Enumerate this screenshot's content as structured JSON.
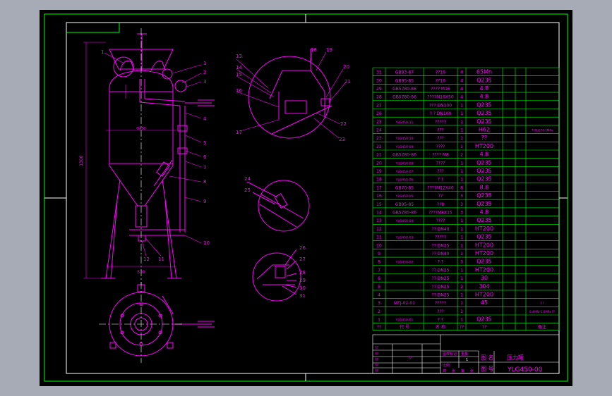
{
  "colors": {
    "canvas": "#000000",
    "frame": "#00ff00",
    "ink": "#ff00ff",
    "text": "#ffffff",
    "window": "#a6abb5"
  },
  "callouts_main": [
    "1",
    "2",
    "3",
    "4",
    "5",
    "6",
    "7",
    "8",
    "9",
    "10",
    "11",
    "12"
  ],
  "callouts_detail_top": [
    "13",
    "14",
    "15",
    "16",
    "17",
    "18",
    "19",
    "20",
    "21",
    "22",
    "23"
  ],
  "callouts_detail_mid": [
    "24",
    "25"
  ],
  "callouts_detail_low": [
    "26",
    "27",
    "28",
    "29",
    "30",
    "31"
  ],
  "dims": {
    "height": "1300",
    "diameter": "Φ450",
    "base": "530",
    "top_left": "Φ",
    "top_right": "Φ"
  },
  "bom_rows": [
    {
      "no": "31",
      "code": "GB93-87",
      "name": "??16",
      "qty": "4",
      "mat": "65Mn",
      "note": ""
    },
    {
      "no": "30",
      "code": "GB95-85",
      "name": "??16",
      "qty": "4",
      "mat": "Q235",
      "note": ""
    },
    {
      "no": "29",
      "code": "GB5780-86",
      "name": "????  M16",
      "qty": "4",
      "mat": "4.8",
      "note": ""
    },
    {
      "no": "28",
      "code": "GB5780-86",
      "name": "????M16X50",
      "qty": "4",
      "mat": "4.8",
      "note": ""
    },
    {
      "no": "27",
      "code": "",
      "name": "???  DN100",
      "qty": "1",
      "mat": "Q235",
      "note": ""
    },
    {
      "no": "26",
      "code": "",
      "name": "? ?  DN100",
      "qty": "1",
      "mat": "Q235",
      "note": ""
    },
    {
      "no": "25",
      "code": "YLG450-11",
      "name": "?????",
      "qty": "1",
      "mat": "Q235",
      "note": ""
    },
    {
      "no": "24",
      "code": "",
      "name": "???",
      "qty": "1",
      "mat": "H62",
      "note": "???1/270-1MPa"
    },
    {
      "no": "23",
      "code": "YLG450-10",
      "name": "???",
      "qty": "1",
      "mat": "??",
      "note": ""
    },
    {
      "no": "22",
      "code": "YLG450-09",
      "name": "????",
      "qty": "1",
      "mat": "HT200",
      "note": ""
    },
    {
      "no": "21",
      "code": "GB5780-86",
      "name": "????  M8",
      "qty": "2",
      "mat": "4.8",
      "note": ""
    },
    {
      "no": "20",
      "code": "YLG450-08",
      "name": "????",
      "qty": "1",
      "mat": "Q235",
      "note": ""
    },
    {
      "no": "19",
      "code": "YLG450-07",
      "name": "???",
      "qty": "1",
      "mat": "Q235",
      "note": ""
    },
    {
      "no": "18",
      "code": "YLG450-06",
      "name": "? ?",
      "qty": "1",
      "mat": "Q235",
      "note": ""
    },
    {
      "no": "17",
      "code": "GB70-85",
      "name": "????M12X40",
      "qty": "8",
      "mat": "8.8",
      "note": ""
    },
    {
      "no": "16",
      "code": "YLG450-05",
      "name": "??",
      "qty": "3",
      "mat": "Q235",
      "note": ""
    },
    {
      "no": "15",
      "code": "GB95-85",
      "name": "??8",
      "qty": "3",
      "mat": "Q235",
      "note": ""
    },
    {
      "no": "14",
      "code": "GB5780-86",
      "name": "????M8X15",
      "qty": "3",
      "mat": "4.8",
      "note": ""
    },
    {
      "no": "13",
      "code": "YLG450-04",
      "name": "????",
      "qty": "1",
      "mat": "Q235",
      "note": ""
    },
    {
      "no": "12",
      "code": "",
      "name": "??  DN40",
      "qty": "1",
      "mat": "HT200",
      "note": ""
    },
    {
      "no": "11",
      "code": "YLG450-03",
      "name": "?????",
      "qty": "1",
      "mat": "Q235",
      "note": ""
    },
    {
      "no": "10",
      "code": "",
      "name": "??  DN25",
      "qty": "1",
      "mat": "HT200",
      "note": ""
    },
    {
      "no": "9",
      "code": "",
      "name": "??  DN40",
      "qty": "1",
      "mat": "HT200",
      "note": ""
    },
    {
      "no": "8",
      "code": "YLG450-02",
      "name": "? ?",
      "qty": "3",
      "mat": "Q235",
      "note": ""
    },
    {
      "no": "7",
      "code": "",
      "name": "??  DN25",
      "qty": "1",
      "mat": "HT200",
      "note": ""
    },
    {
      "no": "6",
      "code": "",
      "name": "??  DN25",
      "qty": "1",
      "mat": "30",
      "note": ""
    },
    {
      "no": "5",
      "code": "",
      "name": "??  DN25",
      "qty": "2",
      "mat": "304",
      "note": ""
    },
    {
      "no": "4",
      "code": "",
      "name": "??  DN25",
      "qty": "1",
      "mat": "HT200",
      "note": ""
    },
    {
      "no": "3",
      "code": "MTJ-02-01",
      "name": "?????",
      "qty": "1",
      "mat": "45",
      "note": "? ?"
    },
    {
      "no": "2",
      "code": "",
      "name": "???",
      "qty": "1",
      "mat": "",
      "note": "0.4MPa-1.6MPa ??"
    },
    {
      "no": "1",
      "code": "YLG450-01",
      "name": "? ?",
      "qty": "1",
      "mat": "Q235",
      "note": ""
    }
  ],
  "bom_header": {
    "no": "??",
    "code": "代  号",
    "name": "名  称",
    "qty": "??",
    "mat": "??",
    "note": "备注"
  },
  "title_block": {
    "grid_labels": [
      "??",
      "??",
      "??",
      "??",
      "??",
      "??"
    ],
    "mid_labels": [
      "图样标记",
      "重量",
      "比例",
      "共",
      "张",
      "第",
      "张"
    ],
    "scale_value": "1",
    "name_label": "图 名",
    "name_value": "压力罐",
    "drawing_no_label": "图 号",
    "drawing_no_value": "YLG450-00"
  }
}
